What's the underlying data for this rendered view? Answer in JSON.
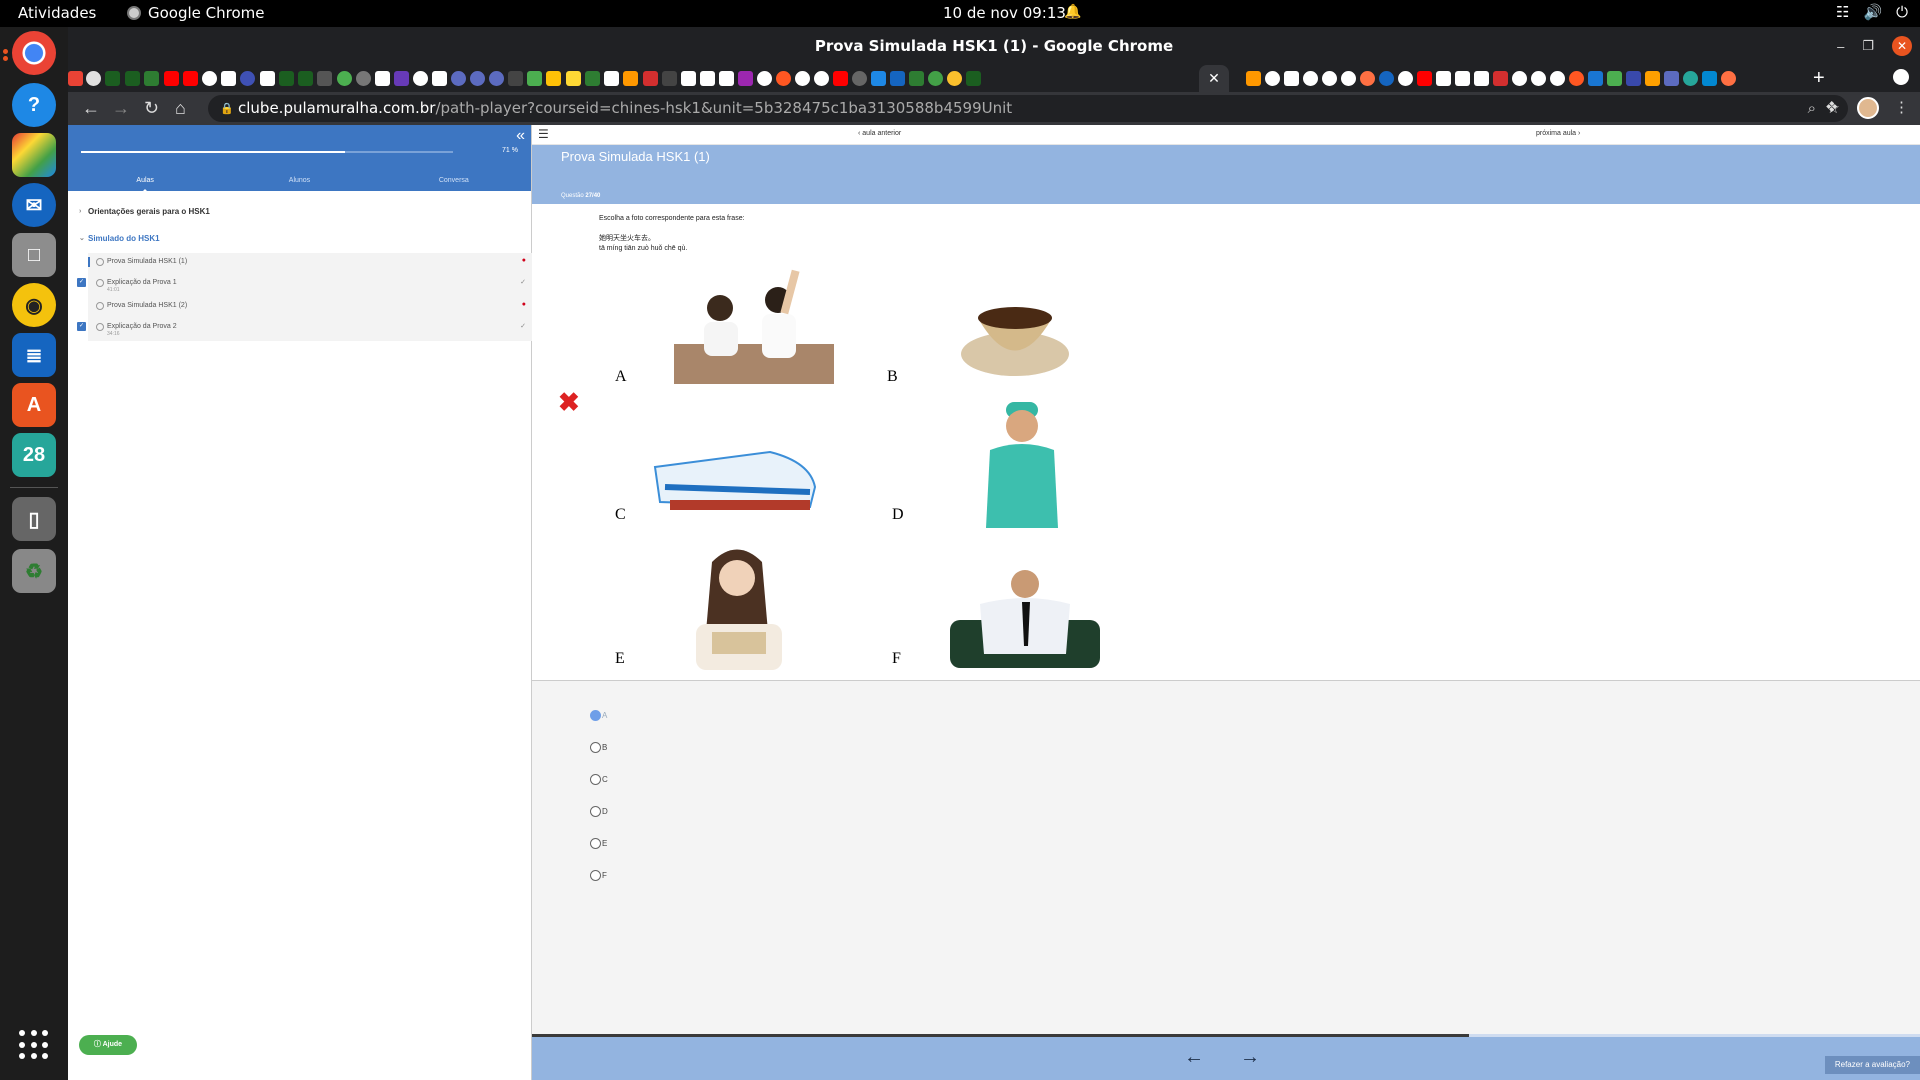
{
  "system": {
    "activities": "Atividades",
    "app_name": "Google Chrome",
    "clock": "10 de nov  09:13"
  },
  "dock": {
    "calendar_day": "28"
  },
  "window": {
    "title": "Prova Simulada HSK1 (1) - Google Chrome"
  },
  "browser": {
    "url_host": "clube.pulamuralha.com.br",
    "url_path": "/path-player?courseid=chines-hsk1&unit=5b328475c1ba3130588b4599Unit"
  },
  "sidebar": {
    "progress_percent": 71,
    "progress_label": "71 %",
    "tabs": [
      "Aulas",
      "Alunos",
      "Conversa"
    ],
    "sections": [
      {
        "title": "Orientações gerais para o HSK1"
      },
      {
        "title": "Simulado do HSK1"
      }
    ],
    "lessons": [
      {
        "name": "Prova Simulada HSK1 (1)",
        "sub": "",
        "status": "pending"
      },
      {
        "name": "Explicação da Prova 1",
        "sub": "41:01",
        "status": "done"
      },
      {
        "name": "Prova Simulada HSK1 (2)",
        "sub": "",
        "status": "pending"
      },
      {
        "name": "Explicação da Prova 2",
        "sub": "34:16",
        "status": "done"
      }
    ],
    "help_label": "Ajude"
  },
  "main": {
    "prev_label": "aula anterior",
    "next_label": "próxima aula",
    "title": "Prova Simulada HSK1 (1)",
    "question_prefix": "Questão",
    "question_number": "27/40",
    "instruction": "Escolha a foto correspondente para esta frase:",
    "hanzi": "她明天坐火车去。",
    "pinyin": "tā míng tiān zuò huǒ chē qù.",
    "image_letters": [
      "A",
      "B",
      "C",
      "D",
      "E",
      "F"
    ],
    "options": [
      "A",
      "B",
      "C",
      "D",
      "E",
      "F"
    ],
    "selected_option": "A",
    "redo_label": "Refazer a avaliação?",
    "footer_progress": 0.675
  }
}
